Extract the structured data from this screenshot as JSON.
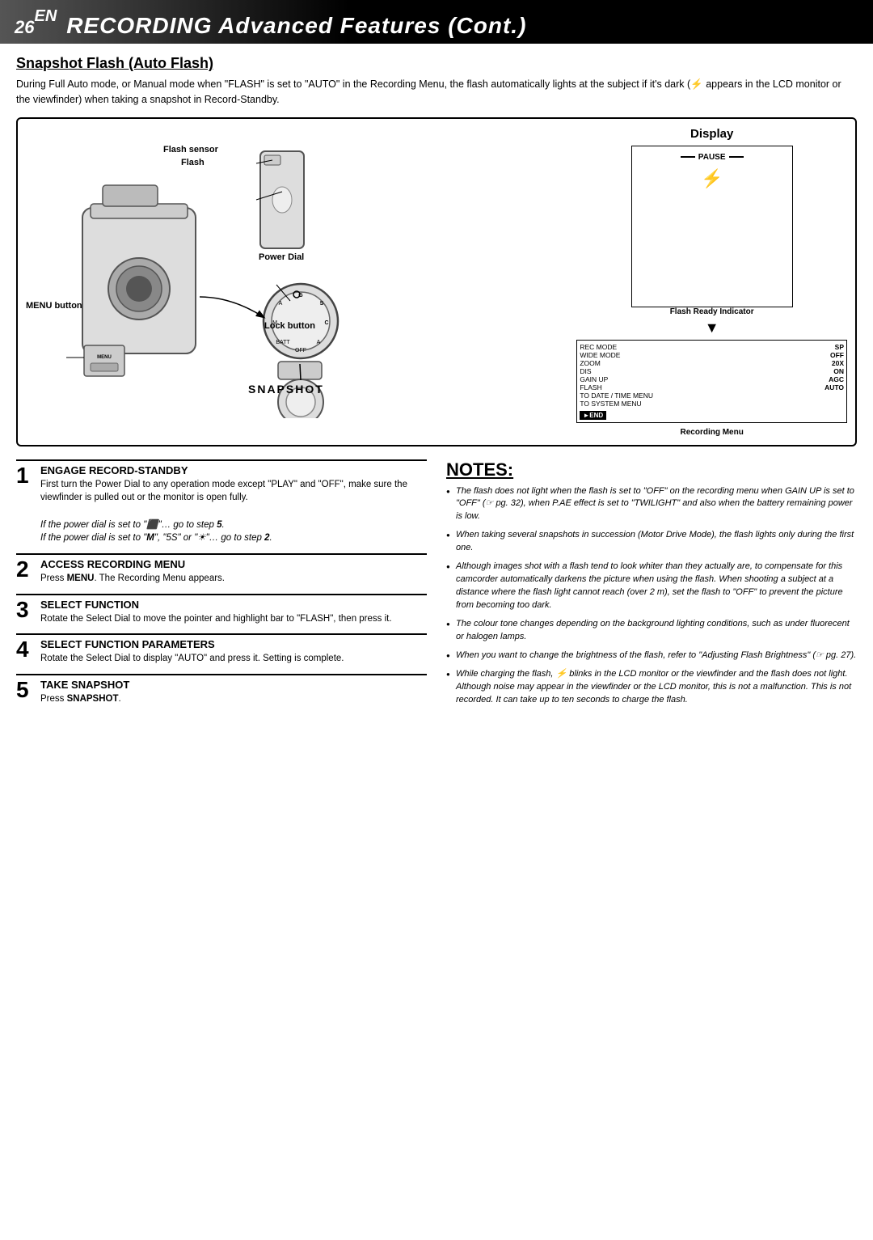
{
  "header": {
    "page_number": "26",
    "page_number_suffix": "EN",
    "title": "RECORDING Advanced Features (Cont.)"
  },
  "section": {
    "heading": "Snapshot Flash (Auto Flash)",
    "intro": "During Full Auto mode, or Manual mode when \"FLASH\" is set to \"AUTO\" in the Recording Menu, the flash automatically lights at the subject if it's dark (⚡ appears in the LCD monitor or the viewfinder) when taking a snapshot in Record-Standby."
  },
  "diagram": {
    "label_display": "Display",
    "label_flash_sensor": "Flash sensor",
    "label_flash": "Flash",
    "label_power_dial": "Power Dial",
    "label_lock_button": "Lock button",
    "label_menu_button": "MENU button",
    "label_snapshot": "SNAPSHOT",
    "label_flash_ready": "Flash Ready Indicator",
    "label_recording_menu": "Recording Menu",
    "display": {
      "pause_text": "PAUSE",
      "rec_mode_label": "REC MODE",
      "rec_mode_value": "SP",
      "wide_mode_label": "WIDE MODE",
      "wide_mode_value": "OFF",
      "zoom_label": "ZOOM",
      "zoom_value": "20X",
      "dis_label": "DIS",
      "dis_value": "ON",
      "gain_up_label": "GAIN UP",
      "gain_up_value": "AGC",
      "flash_label": "FLASH",
      "flash_value": "AUTO",
      "to_date_label": "TO DATE / TIME MENU",
      "to_system_label": "TO SYSTEM MENU",
      "end_text": "►END"
    }
  },
  "steps": [
    {
      "number": "1",
      "title": "ENGAGE RECORD-STANDBY",
      "body": "First turn the Power Dial to any operation mode except \"PLAY\" and \"OFF\", make sure the viewfinder is pulled out or the monitor is open fully.",
      "note1": "If the power dial is set to \"",
      "note1_icon": "A",
      "note1_cont": "\"… go to step 5.",
      "note2": "If the power dial is set to \"",
      "note2_icon": "M",
      "note2_cont": "\", \"5S\" or \"☀\"… go to step 2."
    },
    {
      "number": "2",
      "title": "ACCESS RECORDING MENU",
      "body": "Press MENU. The Recording Menu appears."
    },
    {
      "number": "3",
      "title": "SELECT FUNCTION",
      "body": "Rotate the Select Dial to move the pointer and highlight bar to \"FLASH\", then press it."
    },
    {
      "number": "4",
      "title": "SELECT FUNCTION PARAMETERS",
      "body": "Rotate the Select Dial to display \"AUTO\" and press it. Setting is complete."
    },
    {
      "number": "5",
      "title": "TAKE SNAPSHOT",
      "body": "Press SNAPSHOT."
    }
  ],
  "notes": {
    "title": "NOTES:",
    "items": [
      "The flash does not light when the flash is set to \"OFF\" on the recording menu when GAIN UP is set to \"OFF\" (☞ pg. 32), when P.AE effect is set to \"TWILIGHT\" and also when the battery remaining power is low.",
      "When taking several snapshots in succession (Motor Drive Mode), the flash lights only during the first one.",
      "Although images shot with a flash tend to look whiter than they actually are, to compensate for this camcorder automatically darkens the picture when using the flash. When shooting a subject at a distance where the flash light cannot reach (over 2 m), set the flash to \"OFF\" to prevent the picture from becoming too dark.",
      "The colour tone changes depending on the background lighting conditions, such as under fluorecent or halogen lamps.",
      "When you want to change the brightness of the flash, refer to \"Adjusting Flash Brightness\" (☞ pg. 27).",
      "While charging the flash, ⚡ blinks in the LCD monitor or the viewfinder and the flash does not light. Although noise may appear in the viewfinder or the LCD monitor, this is not a malfunction. This is not recorded. It can take up to ten seconds to charge the flash."
    ]
  }
}
